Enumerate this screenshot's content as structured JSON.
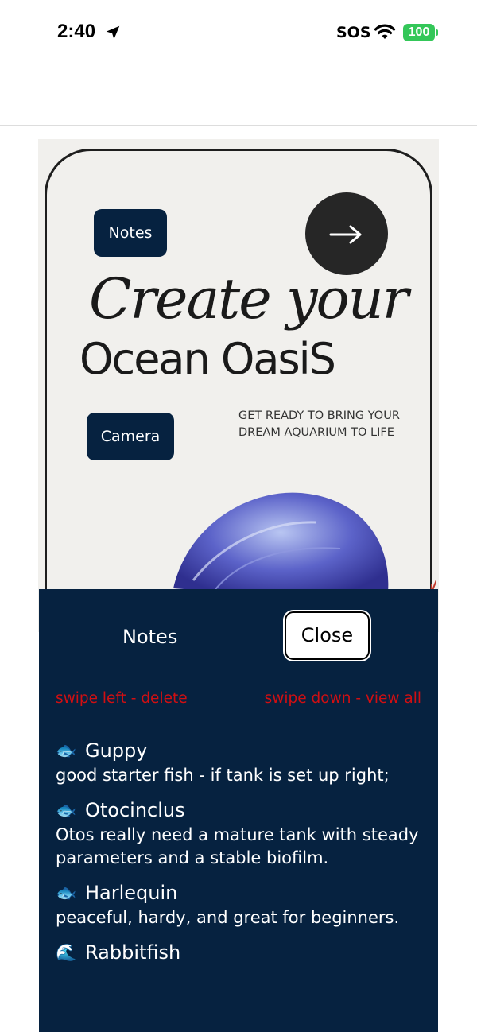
{
  "status_bar": {
    "time": "2:40",
    "carrier": "SOS",
    "battery": "100",
    "battery_color": "#34c759"
  },
  "poster": {
    "notes_button": "Notes",
    "camera_button": "Camera",
    "headline_line1": "Create your",
    "headline_line2": "Ocean OasiS",
    "tagline": "GET READY TO BRING YOUR DREAM AQUARIUM TO LIFE",
    "arrow_icon": "arrow-right-icon",
    "illustration": "jellyfish"
  },
  "panel": {
    "title": "Notes",
    "close_label": "Close",
    "hint_left": "swipe left - delete",
    "hint_right": "swipe down - view all",
    "hint_color": "#d10f12",
    "background": "#062240",
    "notes": [
      {
        "emoji": "🐟",
        "title": "Guppy",
        "body": "good starter fish - if tank is set up right;"
      },
      {
        "emoji": "🐟",
        "title": "Otocinclus",
        "body": "Otos really need a mature tank with steady parameters and a stable biofilm."
      },
      {
        "emoji": "🐟",
        "title": "Harlequin",
        "body": "peaceful, hardy, and great for beginners."
      },
      {
        "emoji": "🌊",
        "title": "Rabbitfish",
        "body": ""
      }
    ]
  }
}
